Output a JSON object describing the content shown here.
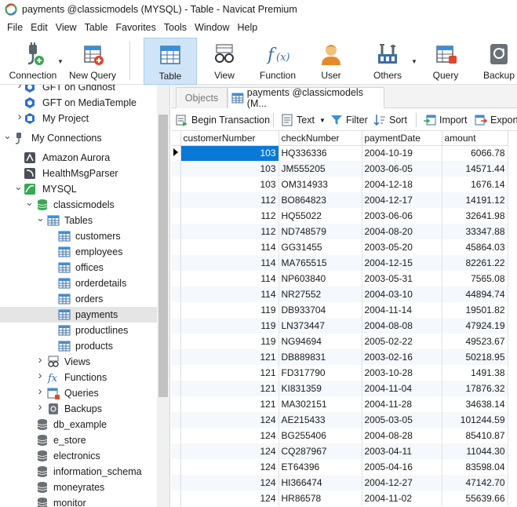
{
  "window": {
    "title": "payments @classicmodels (MYSQL) - Table - Navicat Premium"
  },
  "menu": [
    "File",
    "Edit",
    "View",
    "Table",
    "Favorites",
    "Tools",
    "Window",
    "Help"
  ],
  "toolbar": {
    "connection": "Connection",
    "new_query": "New Query",
    "table": "Table",
    "view": "View",
    "function": "Function",
    "user": "User",
    "others": "Others",
    "query": "Query",
    "backup": "Backup"
  },
  "sidebar": {
    "items": [
      {
        "label": "GFT on Ghdhost",
        "icon": "cloud-db-icon"
      },
      {
        "label": "GFT on MediaTemple",
        "icon": "cloud-db-icon"
      },
      {
        "label": "My Project",
        "icon": "project-icon"
      },
      {
        "label": "My Connections",
        "icon": "connections-icon"
      },
      {
        "label": "Amazon Aurora",
        "icon": "aurora-icon"
      },
      {
        "label": "HealthMsgParser",
        "icon": "connection-icon"
      },
      {
        "label": "MYSQL",
        "icon": "mysql-connection-icon"
      },
      {
        "label": "classicmodels",
        "icon": "database-icon"
      },
      {
        "label": "Tables",
        "icon": "tables-folder-icon"
      },
      {
        "label": "customers",
        "icon": "table-icon"
      },
      {
        "label": "employees",
        "icon": "table-icon"
      },
      {
        "label": "offices",
        "icon": "table-icon"
      },
      {
        "label": "orderdetails",
        "icon": "table-icon"
      },
      {
        "label": "orders",
        "icon": "table-icon"
      },
      {
        "label": "payments",
        "icon": "table-icon"
      },
      {
        "label": "productlines",
        "icon": "table-icon"
      },
      {
        "label": "products",
        "icon": "table-icon"
      },
      {
        "label": "Views",
        "icon": "views-icon"
      },
      {
        "label": "Functions",
        "icon": "function-icon"
      },
      {
        "label": "Queries",
        "icon": "queries-icon"
      },
      {
        "label": "Backups",
        "icon": "backup-icon"
      },
      {
        "label": "db_example",
        "icon": "database-icon"
      },
      {
        "label": "e_store",
        "icon": "database-icon"
      },
      {
        "label": "electronics",
        "icon": "database-icon"
      },
      {
        "label": "information_schema",
        "icon": "database-icon"
      },
      {
        "label": "moneyrates",
        "icon": "database-icon"
      },
      {
        "label": "monitor",
        "icon": "database-icon"
      }
    ]
  },
  "tabs": {
    "objects": "Objects",
    "payments": "payments @classicmodels (M..."
  },
  "datatoolbar": {
    "begin_transaction": "Begin Transaction",
    "text": "Text",
    "filter": "Filter",
    "sort": "Sort",
    "import": "Import",
    "export": "Export"
  },
  "grid": {
    "columns": [
      "customerNumber",
      "checkNumber",
      "paymentDate",
      "amount"
    ],
    "rows": [
      [
        "103",
        "HQ336336",
        "2004-10-19",
        "6066.78"
      ],
      [
        "103",
        "JM555205",
        "2003-06-05",
        "14571.44"
      ],
      [
        "103",
        "OM314933",
        "2004-12-18",
        "1676.14"
      ],
      [
        "112",
        "BO864823",
        "2004-12-17",
        "14191.12"
      ],
      [
        "112",
        "HQ55022",
        "2003-06-06",
        "32641.98"
      ],
      [
        "112",
        "ND748579",
        "2004-08-20",
        "33347.88"
      ],
      [
        "114",
        "GG31455",
        "2003-05-20",
        "45864.03"
      ],
      [
        "114",
        "MA765515",
        "2004-12-15",
        "82261.22"
      ],
      [
        "114",
        "NP603840",
        "2003-05-31",
        "7565.08"
      ],
      [
        "114",
        "NR27552",
        "2004-03-10",
        "44894.74"
      ],
      [
        "119",
        "DB933704",
        "2004-11-14",
        "19501.82"
      ],
      [
        "119",
        "LN373447",
        "2004-08-08",
        "47924.19"
      ],
      [
        "119",
        "NG94694",
        "2005-02-22",
        "49523.67"
      ],
      [
        "121",
        "DB889831",
        "2003-02-16",
        "50218.95"
      ],
      [
        "121",
        "FD317790",
        "2003-10-28",
        "1491.38"
      ],
      [
        "121",
        "KI831359",
        "2004-11-04",
        "17876.32"
      ],
      [
        "121",
        "MA302151",
        "2004-11-28",
        "34638.14"
      ],
      [
        "124",
        "AE215433",
        "2005-03-05",
        "101244.59"
      ],
      [
        "124",
        "BG255406",
        "2004-08-28",
        "85410.87"
      ],
      [
        "124",
        "CQ287967",
        "2003-04-11",
        "11044.30"
      ],
      [
        "124",
        "ET64396",
        "2005-04-16",
        "83598.04"
      ],
      [
        "124",
        "HI366474",
        "2004-12-27",
        "47142.70"
      ],
      [
        "124",
        "HR86578",
        "2004-11-02",
        "55639.66"
      ]
    ]
  },
  "colors": {
    "accent": "#0a78d7",
    "selected_toolbar": "#cfe5f7",
    "alt_row": "#f5f8fc"
  }
}
